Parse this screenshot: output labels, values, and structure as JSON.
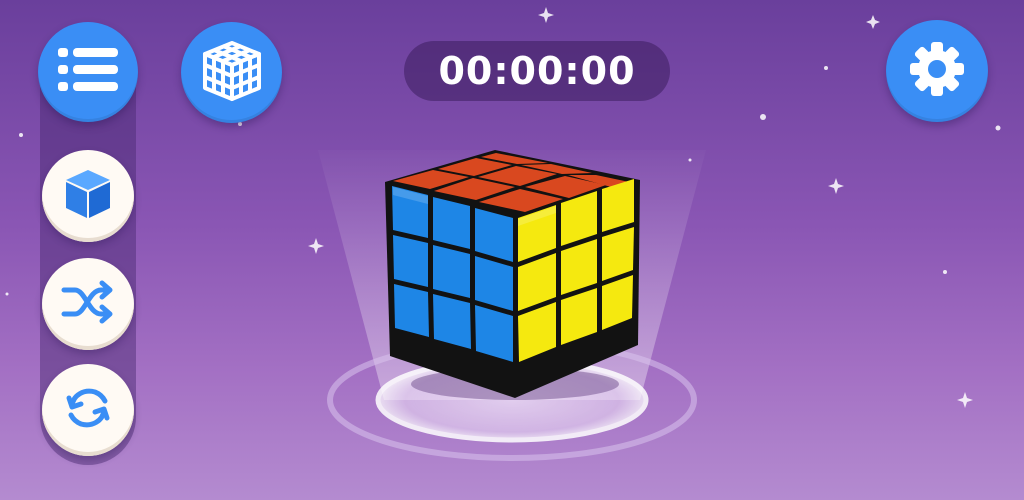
{
  "timer": {
    "value": "00:00:00"
  },
  "controls": {
    "menu": {
      "icon": "list-icon"
    },
    "cube_view": {
      "icon": "cube-grid-icon"
    },
    "settings": {
      "icon": "gear-icon"
    },
    "solid_cube": {
      "icon": "cube-icon"
    },
    "shuffle": {
      "icon": "shuffle-icon"
    },
    "reset": {
      "icon": "refresh-icon"
    }
  },
  "cube": {
    "type": "3x3 puzzle cube",
    "faces": {
      "top": "red",
      "left": "blue",
      "right": "yellow"
    }
  },
  "colors": {
    "button_blue": "#3a8ef5",
    "button_white": "#fffaf4",
    "icon_blue": "#3a8ef5",
    "cube_red": "#d9481f",
    "cube_blue": "#1e86e6",
    "cube_yellow": "#f5e90f",
    "background_top": "#6a3f9c",
    "background_bottom": "#b48bd0"
  }
}
